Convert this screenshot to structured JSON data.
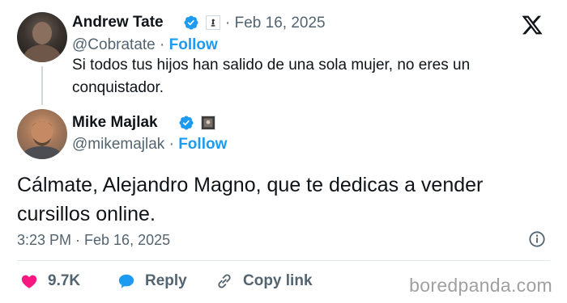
{
  "colors": {
    "accent": "#1d9bf0",
    "like": "#f91880",
    "text": "#0f1419",
    "muted": "#536471"
  },
  "tweet": {
    "author_name": "Andrew Tate",
    "handle": "@Cobratate",
    "separator": "·",
    "follow_label": "Follow",
    "date": "· Feb 16, 2025",
    "text": "Si todos tus hijos han salido de una sola mujer, no eres un conquistador."
  },
  "reply": {
    "author_name": "Mike Majlak",
    "handle": "@mikemajlak",
    "separator": "·",
    "follow_label": "Follow",
    "text": "Cálmate, Alejandro Magno, que te dedicas a vender cursillos online.",
    "timestamp": "3:23 PM · Feb 16, 2025"
  },
  "actions": {
    "like_count": "9.7K",
    "reply_label": "Reply",
    "copy_link_label": "Copy link"
  },
  "icons": [
    "x-logo-icon",
    "verified-badge-icon",
    "affiliate-badge-icon",
    "info-icon",
    "heart-icon",
    "reply-bubble-icon",
    "link-icon"
  ],
  "watermark": "boredpanda.com"
}
